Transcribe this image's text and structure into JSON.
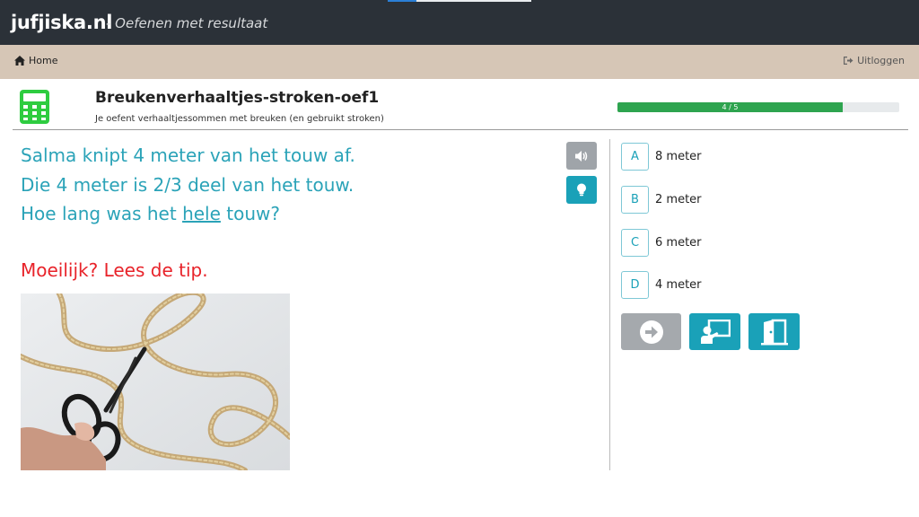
{
  "app": {
    "brand": "jufjiska.nl",
    "tagline": "- Oefenen met resultaat"
  },
  "nav": {
    "home_label": "Home",
    "home_icon": "home-icon",
    "logout_label": "Uitloggen",
    "logout_icon": "sign-out-icon"
  },
  "lesson": {
    "title": "Breukenverhaaltjes-stroken-oef1",
    "subtitle": "Je oefent verhaaltjessommen met breuken (en gebruikt stroken)",
    "icon": "calculator-icon",
    "icon_color": "#2ecc40"
  },
  "progress": {
    "label": "4 / 5",
    "current": 4,
    "total": 5,
    "fraction": 0.8,
    "color": "#2ea44f"
  },
  "question": {
    "line1": "Salma knipt 4 meter van het touw af.",
    "line2": "Die 4 meter is 2/3 deel van het touw.",
    "line3_before": "Hoe lang was het ",
    "line3_underlined": "hele",
    "line3_after": " touw?",
    "tip": "Moeilijk? Lees de tip.",
    "text_color": "#2ba3b8",
    "tip_color": "#e8232a",
    "image": "scissors-and-rope-photo"
  },
  "answers": [
    {
      "letter": "A",
      "text": "8 meter"
    },
    {
      "letter": "B",
      "text": "2 meter"
    },
    {
      "letter": "C",
      "text": "6 meter"
    },
    {
      "letter": "D",
      "text": "4 meter"
    }
  ],
  "actions": {
    "sound_icon": "volume-icon",
    "tip_icon": "lightbulb-icon",
    "next_icon": "arrow-right-circle-icon",
    "board_icon": "teacher-board-icon",
    "exit_icon": "door-exit-icon"
  },
  "colors": {
    "topbar": "#2b3138",
    "navbar": "#d6c6b6",
    "accent": "#1aa1b8",
    "muted_button": "#a5a9ad"
  }
}
